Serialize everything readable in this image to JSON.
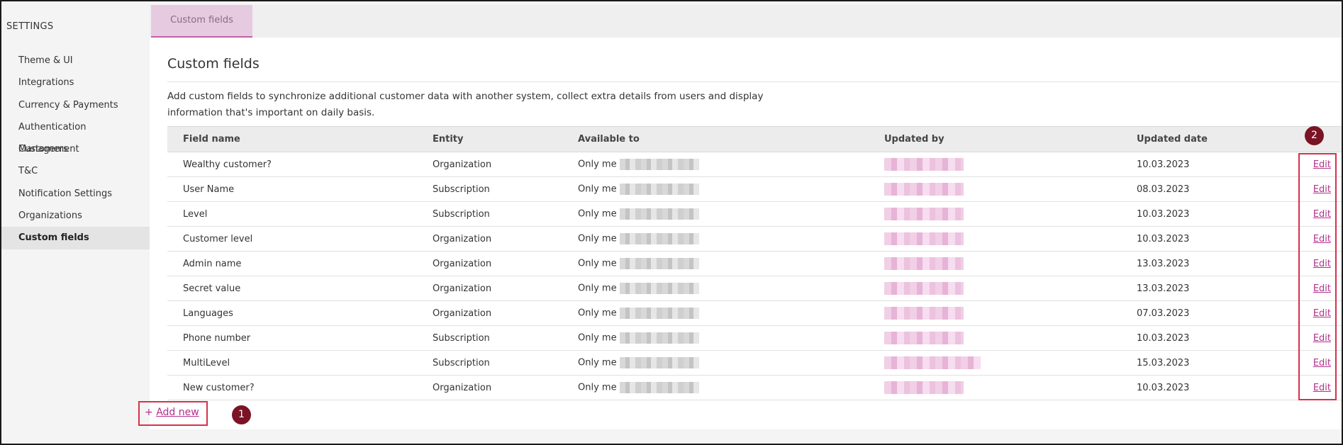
{
  "sidebar": {
    "title": "SETTINGS",
    "items": [
      {
        "label": "Theme & UI"
      },
      {
        "label": "Integrations"
      },
      {
        "label": "Currency & Payments"
      },
      {
        "label": "Authentication Management"
      },
      {
        "label": "Customers"
      },
      {
        "label": "T&C"
      },
      {
        "label": "Notification Settings"
      },
      {
        "label": "Organizations"
      },
      {
        "label": "Custom fields",
        "active": true
      }
    ]
  },
  "tabs": {
    "active_label": "Custom fields"
  },
  "main": {
    "title": "Custom fields",
    "description": "Add custom fields to synchronize additional customer data with another system, collect extra details from users and display information that's important on daily basis.",
    "add_new_prefix": "+",
    "add_new_label": "Add new",
    "edit_label": "Edit"
  },
  "table": {
    "columns": [
      "Field name",
      "Entity",
      "Available to",
      "Updated by",
      "Updated date",
      ""
    ],
    "rows": [
      {
        "field_name": "Wealthy customer?",
        "entity": "Organization",
        "available_to": "Only me",
        "updated_date": "10.03.2023"
      },
      {
        "field_name": "User Name",
        "entity": "Subscription",
        "available_to": "Only me",
        "updated_date": "08.03.2023"
      },
      {
        "field_name": "Level",
        "entity": "Subscription",
        "available_to": "Only me",
        "updated_date": "10.03.2023"
      },
      {
        "field_name": "Customer level",
        "entity": "Organization",
        "available_to": "Only me",
        "updated_date": "10.03.2023"
      },
      {
        "field_name": "Admin name",
        "entity": "Organization",
        "available_to": "Only me",
        "updated_date": "13.03.2023"
      },
      {
        "field_name": "Secret value",
        "entity": "Organization",
        "available_to": "Only me",
        "updated_date": "13.03.2023"
      },
      {
        "field_name": "Languages",
        "entity": "Organization",
        "available_to": "Only me",
        "updated_date": "07.03.2023"
      },
      {
        "field_name": "Phone number",
        "entity": "Subscription",
        "available_to": "Only me",
        "updated_date": "10.03.2023"
      },
      {
        "field_name": "MultiLevel",
        "entity": "Subscription",
        "available_to": "Only me",
        "updated_date": "15.03.2023"
      },
      {
        "field_name": "New customer?",
        "entity": "Organization",
        "available_to": "Only me",
        "updated_date": "10.03.2023"
      }
    ]
  },
  "annotations": {
    "callout_1": "1",
    "callout_2": "2"
  },
  "colors": {
    "accent": "#b3308c",
    "active_tab_bg": "#e6cbe0",
    "callout_bg": "#7a1424",
    "highlight_border": "#d6314a"
  }
}
